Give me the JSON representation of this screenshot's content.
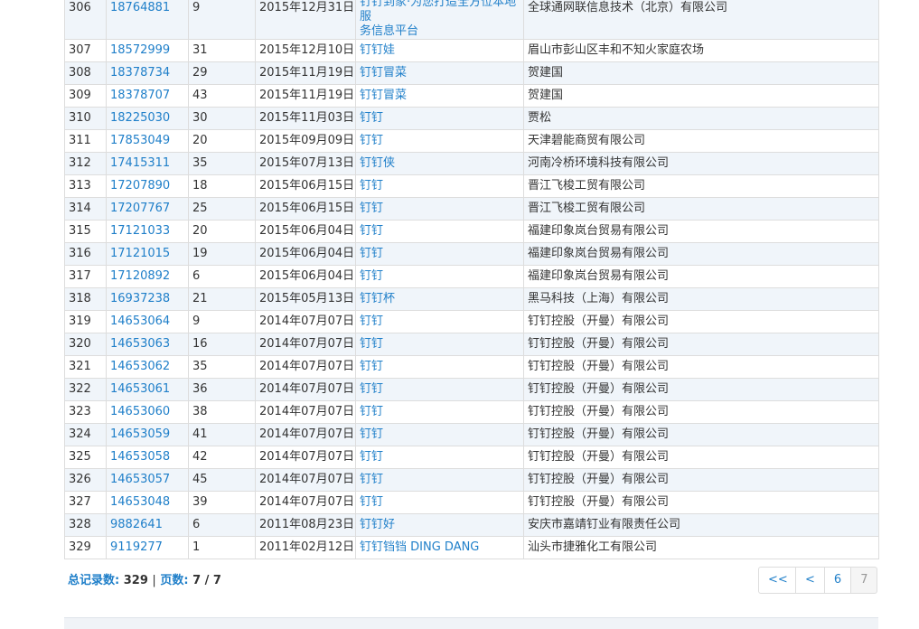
{
  "rows": [
    {
      "no": "306",
      "reg": "18764881",
      "cls": "9",
      "date": "2015年12月31日",
      "name_line1": "钉钉到家·为您打造全方位本地服",
      "name_line2": "务信息平台",
      "owner": "全球通网联信息技术（北京）有限公司"
    },
    {
      "no": "307",
      "reg": "18572999",
      "cls": "31",
      "date": "2015年12月10日",
      "name": "钉钉娃",
      "owner": "眉山市彭山区丰和不知火家庭农场"
    },
    {
      "no": "308",
      "reg": "18378734",
      "cls": "29",
      "date": "2015年11月19日",
      "name": "钉钉冒菜",
      "owner": "贺建国"
    },
    {
      "no": "309",
      "reg": "18378707",
      "cls": "43",
      "date": "2015年11月19日",
      "name": "钉钉冒菜",
      "owner": "贺建国"
    },
    {
      "no": "310",
      "reg": "18225030",
      "cls": "30",
      "date": "2015年11月03日",
      "name": "钉钉",
      "owner": "贾松"
    },
    {
      "no": "311",
      "reg": "17853049",
      "cls": "20",
      "date": "2015年09月09日",
      "name": "钉钉",
      "owner": "天津碧能商贸有限公司"
    },
    {
      "no": "312",
      "reg": "17415311",
      "cls": "35",
      "date": "2015年07月13日",
      "name": "钉钉侠",
      "owner": "河南冷桥环境科技有限公司"
    },
    {
      "no": "313",
      "reg": "17207890",
      "cls": "18",
      "date": "2015年06月15日",
      "name": "钉钉",
      "owner": "晋江飞梭工贸有限公司"
    },
    {
      "no": "314",
      "reg": "17207767",
      "cls": "25",
      "date": "2015年06月15日",
      "name": "钉钉",
      "owner": "晋江飞梭工贸有限公司"
    },
    {
      "no": "315",
      "reg": "17121033",
      "cls": "20",
      "date": "2015年06月04日",
      "name": "钉钉",
      "owner": "福建印象岚台贸易有限公司"
    },
    {
      "no": "316",
      "reg": "17121015",
      "cls": "19",
      "date": "2015年06月04日",
      "name": "钉钉",
      "owner": "福建印象岚台贸易有限公司"
    },
    {
      "no": "317",
      "reg": "17120892",
      "cls": "6",
      "date": "2015年06月04日",
      "name": "钉钉",
      "owner": "福建印象岚台贸易有限公司"
    },
    {
      "no": "318",
      "reg": "16937238",
      "cls": "21",
      "date": "2015年05月13日",
      "name": "钉钉杯",
      "owner": "黑马科技（上海）有限公司"
    },
    {
      "no": "319",
      "reg": "14653064",
      "cls": "9",
      "date": "2014年07月07日",
      "name": "钉钉",
      "owner": "钉钉控股（开曼）有限公司"
    },
    {
      "no": "320",
      "reg": "14653063",
      "cls": "16",
      "date": "2014年07月07日",
      "name": "钉钉",
      "owner": "钉钉控股（开曼）有限公司"
    },
    {
      "no": "321",
      "reg": "14653062",
      "cls": "35",
      "date": "2014年07月07日",
      "name": "钉钉",
      "owner": "钉钉控股（开曼）有限公司"
    },
    {
      "no": "322",
      "reg": "14653061",
      "cls": "36",
      "date": "2014年07月07日",
      "name": "钉钉",
      "owner": "钉钉控股（开曼）有限公司"
    },
    {
      "no": "323",
      "reg": "14653060",
      "cls": "38",
      "date": "2014年07月07日",
      "name": "钉钉",
      "owner": "钉钉控股（开曼）有限公司"
    },
    {
      "no": "324",
      "reg": "14653059",
      "cls": "41",
      "date": "2014年07月07日",
      "name": "钉钉",
      "owner": "钉钉控股（开曼）有限公司"
    },
    {
      "no": "325",
      "reg": "14653058",
      "cls": "42",
      "date": "2014年07月07日",
      "name": "钉钉",
      "owner": "钉钉控股（开曼）有限公司"
    },
    {
      "no": "326",
      "reg": "14653057",
      "cls": "45",
      "date": "2014年07月07日",
      "name": "钉钉",
      "owner": "钉钉控股（开曼）有限公司"
    },
    {
      "no": "327",
      "reg": "14653048",
      "cls": "39",
      "date": "2014年07月07日",
      "name": "钉钉",
      "owner": "钉钉控股（开曼）有限公司"
    },
    {
      "no": "328",
      "reg": "9882641",
      "cls": "6",
      "date": "2011年08月23日",
      "name": "钉钉好",
      "owner": "安庆市嘉靖钉业有限责任公司"
    },
    {
      "no": "329",
      "reg": "9119277",
      "cls": "1",
      "date": "2011年02月12日",
      "name": "钉钉铛铛 DING DANG",
      "owner": "汕头市捷雅化工有限公司"
    }
  ],
  "summary": {
    "total_label": "总记录数:",
    "total_value": "329",
    "separator": "|",
    "pages_label": "页数:",
    "pages_value": "7 / 7"
  },
  "pager": {
    "first": "<<",
    "prev": "<",
    "page6": "6",
    "page7": "7"
  },
  "colors": {
    "link": "#1f7fc9",
    "row_stripe": "#f0f5fa",
    "border": "#dddddd"
  }
}
